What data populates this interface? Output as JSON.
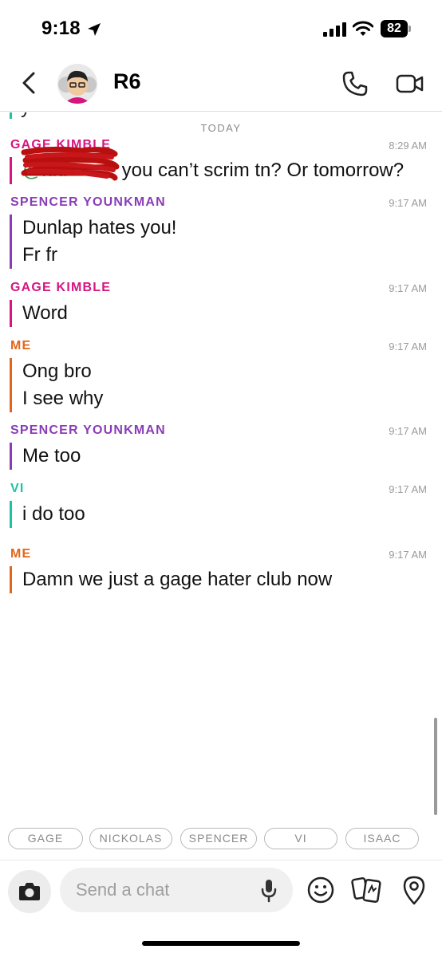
{
  "status_bar": {
    "time": "9:18",
    "battery": "82"
  },
  "header": {
    "group_name": "R6"
  },
  "chat": {
    "peek_text": "y",
    "day_divider": "TODAY",
    "messages": [
      {
        "sender": "GAGE KIMBLE",
        "time": "8:29 AM",
        "mention": "@lud",
        "lines": [
          "you can’t scrim tn? Or tomorrow?"
        ]
      },
      {
        "sender": "SPENCER YOUNKMAN",
        "time": "9:17 AM",
        "lines": [
          "Dunlap hates you!",
          "Fr fr"
        ]
      },
      {
        "sender": "GAGE KIMBLE",
        "time": "9:17 AM",
        "lines": [
          "Word"
        ]
      },
      {
        "sender": "ME",
        "time": "9:17 AM",
        "lines": [
          "Ong bro",
          "I see why"
        ]
      },
      {
        "sender": "SPENCER YOUNKMAN",
        "time": "9:17 AM",
        "lines": [
          "Me too"
        ]
      },
      {
        "sender": "VI",
        "time": "9:17 AM",
        "lines": [
          "i do too"
        ]
      },
      {
        "sender": "ME",
        "time": "9:17 AM",
        "lines": [
          "Damn we just a gage hater club now"
        ]
      }
    ]
  },
  "chips": [
    "GAGE",
    "NICKOLAS",
    "SPENCER",
    "VI",
    "ISAAC"
  ],
  "input": {
    "placeholder": "Send a chat"
  },
  "colors": {
    "gage": "#d6157f",
    "spencer": "#8a3cb8",
    "me": "#e0661a",
    "vi": "#1cc4a4",
    "mention": "#2e9c4a"
  },
  "icons": [
    "location-arrow-icon",
    "signal-icon",
    "wifi-icon",
    "back-icon",
    "phone-icon",
    "video-icon",
    "camera-icon",
    "mic-icon",
    "emoji-icon",
    "cards-icon",
    "location-pin-icon"
  ]
}
